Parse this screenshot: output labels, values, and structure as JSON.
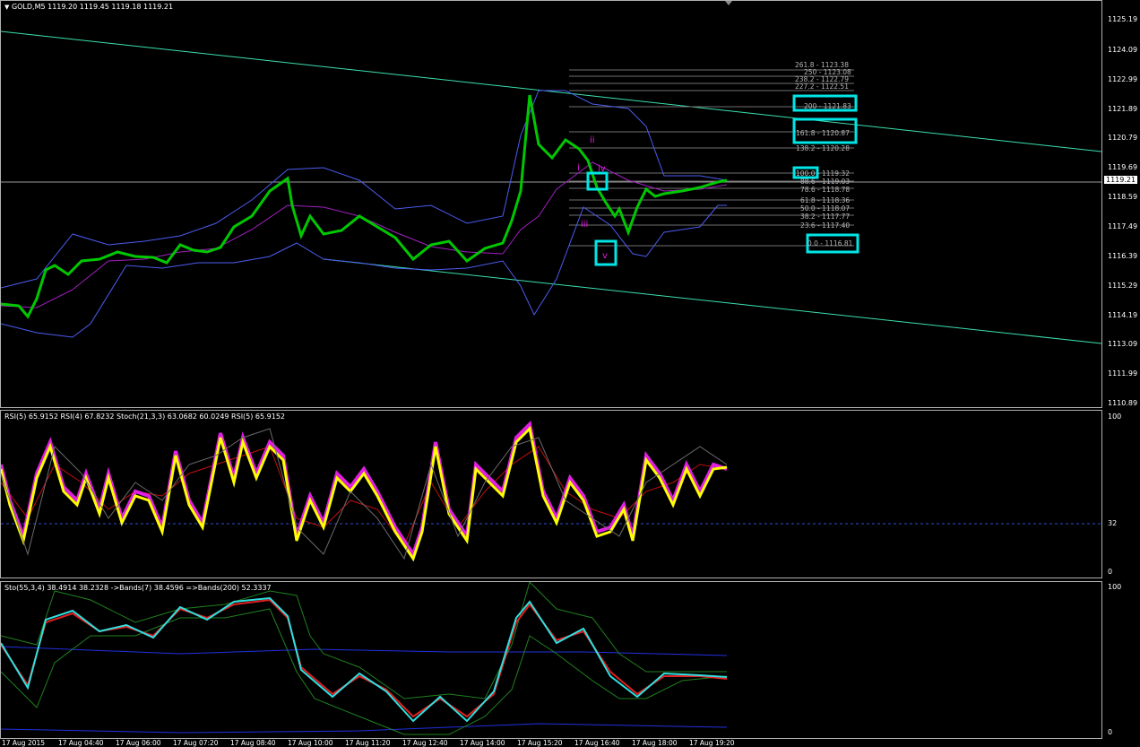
{
  "symbol_header": "GOLD,M5  1119.20 1119.45 1119.18 1119.21",
  "main_scale": [
    "1125.19",
    "1124.09",
    "1122.99",
    "1121.89",
    "1120.79",
    "1119.69",
    "1118.59",
    "1117.49",
    "1116.39",
    "1115.29",
    "1114.19",
    "1113.09",
    "1111.99",
    "1110.89"
  ],
  "current_price": "1119.21",
  "fib_levels": [
    "261.8 - 1123.38",
    "250 - 1123.08",
    "238.2 - 1122.79",
    "227.2 - 1122.51",
    "200 - 1121.83",
    "161.8 - 1120.87",
    "138.2 - 1120.28",
    "100.0 - 1119.32",
    "88.6 - 1119.03",
    "78.6 - 1118.78",
    "61.8 - 1118.36",
    "50.0 - 1118.07",
    "38.2 - 1117.77",
    "23.6 - 1117.40",
    "0.0 - 1116.81"
  ],
  "wave_labels": [
    "i",
    "ii",
    "iii",
    "iv",
    "v"
  ],
  "rsi_header": "RSI(5) 65.9152  RSI(4) 67.8232  Stoch(21,3,3) 63.0682 60.0249  RSI(5) 65.9152",
  "rsi_scale": [
    "100",
    "32",
    "0"
  ],
  "sto_header": "Sto(55,3,4) 38.4914 38.2328   ->Bands(7) 38.4596   =>Bands(200) 52.3337",
  "sto_scale": [
    "100",
    "0"
  ],
  "time_labels": [
    "17 Aug 2015",
    "17 Aug 04:40",
    "17 Aug 06:00",
    "17 Aug 07:20",
    "17 Aug 08:40",
    "17 Aug 10:00",
    "17 Aug 11:20",
    "17 Aug 12:40",
    "17 Aug 14:00",
    "17 Aug 15:20",
    "17 Aug 16:40",
    "17 Aug 18:00",
    "17 Aug 19:20"
  ],
  "colors": {
    "bull": "#00c800",
    "trend": "#3ce0b0",
    "bands": "#4c5cf0",
    "highlight": "#00e5e5",
    "rsi_main": "#ffff00",
    "rsi_shadow": "#e01fe0"
  }
}
